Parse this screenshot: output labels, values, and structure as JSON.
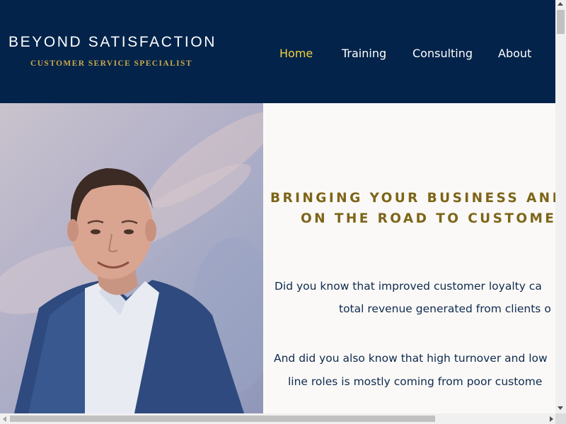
{
  "brand": {
    "title": "BEYOND SATISFACTION",
    "subtitle": "CUSTOMER SERVICE SPECIALIST"
  },
  "nav": {
    "items": [
      {
        "label": "Home",
        "active": true
      },
      {
        "label": "Training",
        "active": false
      },
      {
        "label": "Consulting",
        "active": false
      },
      {
        "label": "About",
        "active": false
      }
    ]
  },
  "hero": {
    "headline_line1": "BRINGING YOUR BUSINESS AND",
    "headline_line2": "ON THE ROAD TO CUSTOMER",
    "para1_line1": "Did you know that improved customer loyalty ca",
    "para1_line2": "total revenue generated from clients o",
    "para2_line1": "And did you also know that high turnover and low",
    "para2_line2": "line roles is mostly coming from poor custome"
  },
  "colors": {
    "header_bg": "#03234a",
    "accent_gold": "#c9a84a",
    "headline_gold": "#7d6518",
    "active_nav": "#f2d23a",
    "body_text": "#0d2a4f"
  }
}
